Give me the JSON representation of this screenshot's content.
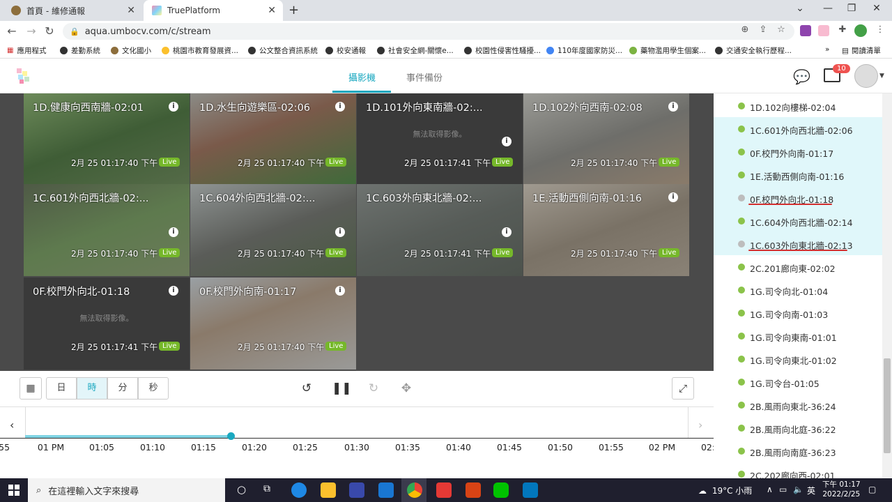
{
  "browser": {
    "tabs": [
      {
        "label": "首頁 - 維修通報",
        "active": false
      },
      {
        "label": "TruePlatform",
        "active": true
      }
    ],
    "url": "aqua.umbocv.com/c/stream",
    "bookmarks": [
      "應用程式",
      "差勤系統",
      "文化國小",
      "桃園市教育發展資...",
      "公文整合資訊系統",
      "校安通報",
      "社會安全網-關懷e...",
      "校園性侵害性騷擾...",
      "110年度國家防災...",
      "藥物濫用學生個案...",
      "交通安全執行歷程..."
    ],
    "reading_list": "閱讀清單"
  },
  "app": {
    "nav_tabs": [
      "攝影機",
      "事件備份"
    ],
    "notification_count": "10",
    "colors": {
      "accent": "#1aa8c0",
      "live": "#76b82a",
      "online": "#8bc34a",
      "offline": "#bdbdbd",
      "highlight": "#e0f7fa"
    }
  },
  "cameras": [
    {
      "name": "1D.健康向西南牆-02:01",
      "timestamp": "2月 25 01:17:40 下午",
      "live": "Live",
      "no_image": ""
    },
    {
      "name": "1D.水生向遊樂區-02:06",
      "timestamp": "2月 25 01:17:40 下午",
      "live": "Live",
      "no_image": ""
    },
    {
      "name": "1D.101外向東南牆-02:...",
      "timestamp": "2月 25 01:17:41 下午",
      "live": "Live",
      "no_image": "無法取得影像。"
    },
    {
      "name": "1D.102外向西南-02:08",
      "timestamp": "2月 25 01:17:40 下午",
      "live": "Live",
      "no_image": ""
    },
    {
      "name": "1C.601外向西北牆-02:...",
      "timestamp": "2月 25 01:17:40 下午",
      "live": "Live",
      "no_image": ""
    },
    {
      "name": "1C.604外向西北牆-02:...",
      "timestamp": "2月 25 01:17:40 下午",
      "live": "Live",
      "no_image": ""
    },
    {
      "name": "1C.603外向東北牆-02:...",
      "timestamp": "2月 25 01:17:41 下午",
      "live": "Live",
      "no_image": ""
    },
    {
      "name": "1E.活動西側向南-01:16",
      "timestamp": "2月 25 01:17:40 下午",
      "live": "Live",
      "no_image": ""
    },
    {
      "name": "0F.校門外向北-01:18",
      "timestamp": "2月 25 01:17:41 下午",
      "live": "Live",
      "no_image": "無法取得影像。"
    },
    {
      "name": "0F.校門外向南-01:17",
      "timestamp": "2月 25 01:17:40 下午",
      "live": "Live",
      "no_image": ""
    }
  ],
  "controls": {
    "time_units": [
      "日",
      "時",
      "分",
      "秒"
    ],
    "selected_unit": "時"
  },
  "timeline": {
    "ticks": [
      ":55",
      "01 PM",
      "01:05",
      "01:10",
      "01:15",
      "01:20",
      "01:25",
      "01:30",
      "01:35",
      "01:40",
      "01:45",
      "01:50",
      "01:55",
      "02 PM",
      "02:"
    ],
    "progress_fraction": 0.31
  },
  "camera_list": [
    {
      "label": "1D.102向樓梯-02:04",
      "status": "online",
      "highlight": false
    },
    {
      "label": "1C.601外向西北牆-02:06",
      "status": "online",
      "highlight": true
    },
    {
      "label": "0F.校門外向南-01:17",
      "status": "online",
      "highlight": true
    },
    {
      "label": "1E.活動西側向南-01:16",
      "status": "online",
      "highlight": true
    },
    {
      "label": "0F.校門外向北-01:18",
      "status": "offline",
      "highlight": true,
      "underlined": true
    },
    {
      "label": "1C.604外向西北牆-02:14",
      "status": "online",
      "highlight": true
    },
    {
      "label": "1C.603外向東北牆-02:13",
      "status": "offline",
      "highlight": true,
      "underlined": true
    },
    {
      "label": "2C.201廊向東-02:02",
      "status": "online",
      "highlight": false
    },
    {
      "label": "1G.司令向北-01:04",
      "status": "online",
      "highlight": false
    },
    {
      "label": "1G.司令向南-01:03",
      "status": "online",
      "highlight": false
    },
    {
      "label": "1G.司令向東南-01:01",
      "status": "online",
      "highlight": false
    },
    {
      "label": "1G.司令向東北-01:02",
      "status": "online",
      "highlight": false
    },
    {
      "label": "1G.司令台-01:05",
      "status": "online",
      "highlight": false
    },
    {
      "label": "2B.風雨向東北-36:24",
      "status": "online",
      "highlight": false
    },
    {
      "label": "2B.風雨向北庭-36:22",
      "status": "online",
      "highlight": false
    },
    {
      "label": "2B.風雨向南庭-36:23",
      "status": "online",
      "highlight": false
    },
    {
      "label": "2C.202廊向西-02:01",
      "status": "online",
      "highlight": false
    }
  ],
  "taskbar": {
    "search_placeholder": "在這裡輸入文字來搜尋",
    "weather": "19°C 小雨",
    "ime": "英",
    "time": "下午 01:17",
    "date": "2022/2/25"
  }
}
